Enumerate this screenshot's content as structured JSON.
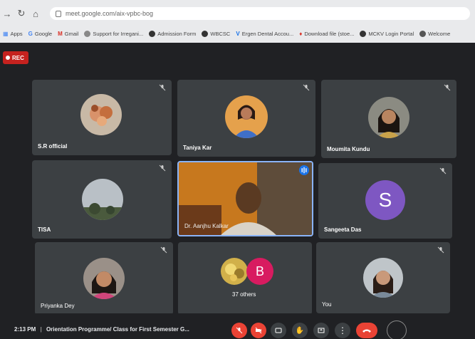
{
  "browser": {
    "url": "meet.google.com/aix-vpbc-bog",
    "bookmarks": [
      {
        "label": "Apps",
        "icon": "apps-icon",
        "color": "#4285f4"
      },
      {
        "label": "Google",
        "icon": "google-icon",
        "color": "#4285f4"
      },
      {
        "label": "Gmail",
        "icon": "gmail-icon",
        "color": "#d93025"
      },
      {
        "label": "Support for Irregani...",
        "icon": "support-icon",
        "color": "#666666"
      },
      {
        "label": "Admission Form",
        "icon": "globe-icon",
        "color": "#333333"
      },
      {
        "label": "WBCSC",
        "icon": "globe-icon",
        "color": "#333333"
      },
      {
        "label": "Ergen Dental Accou...",
        "icon": "dental-icon",
        "color": "#1a73e8"
      },
      {
        "label": "Download file (stoe...",
        "icon": "download-icon",
        "color": "#d93025"
      },
      {
        "label": "MCKV Login Portal",
        "icon": "globe-icon",
        "color": "#333333"
      },
      {
        "label": "Welcome",
        "icon": "welcome-icon",
        "color": "#555555"
      }
    ]
  },
  "meet": {
    "recording_label": "REC",
    "participants": [
      {
        "name": "S.R official",
        "kind": "photo",
        "muted": true
      },
      {
        "name": "Taniya Kar",
        "kind": "photo",
        "muted": true
      },
      {
        "name": "Moumita Kundu",
        "kind": "photo",
        "muted": true
      },
      {
        "name": "TISA",
        "kind": "photo",
        "muted": true
      },
      {
        "name": "Dr. Aanjhu Kalkar",
        "kind": "video",
        "muted": false,
        "speaking": true
      },
      {
        "name": "Sangeeta Das",
        "kind": "letter",
        "letter": "S",
        "color": "#7e57c2",
        "muted": true
      },
      {
        "name": "Priyanka Dey",
        "kind": "photo",
        "muted": true
      },
      {
        "name": "37 others",
        "kind": "group",
        "letter": "B",
        "color": "#d81b60",
        "muted": false
      },
      {
        "name": "You",
        "kind": "photo",
        "muted": true
      }
    ],
    "bottom": {
      "time": "2:13 PM",
      "separator": "|",
      "title": "Orientation Programme/ Class for First Semester G..."
    }
  },
  "colors": {
    "accent_red": "#ea4335",
    "tile_bg": "#3c4043",
    "stage_bg": "#202124",
    "speaking_border": "#8ab4f8"
  }
}
